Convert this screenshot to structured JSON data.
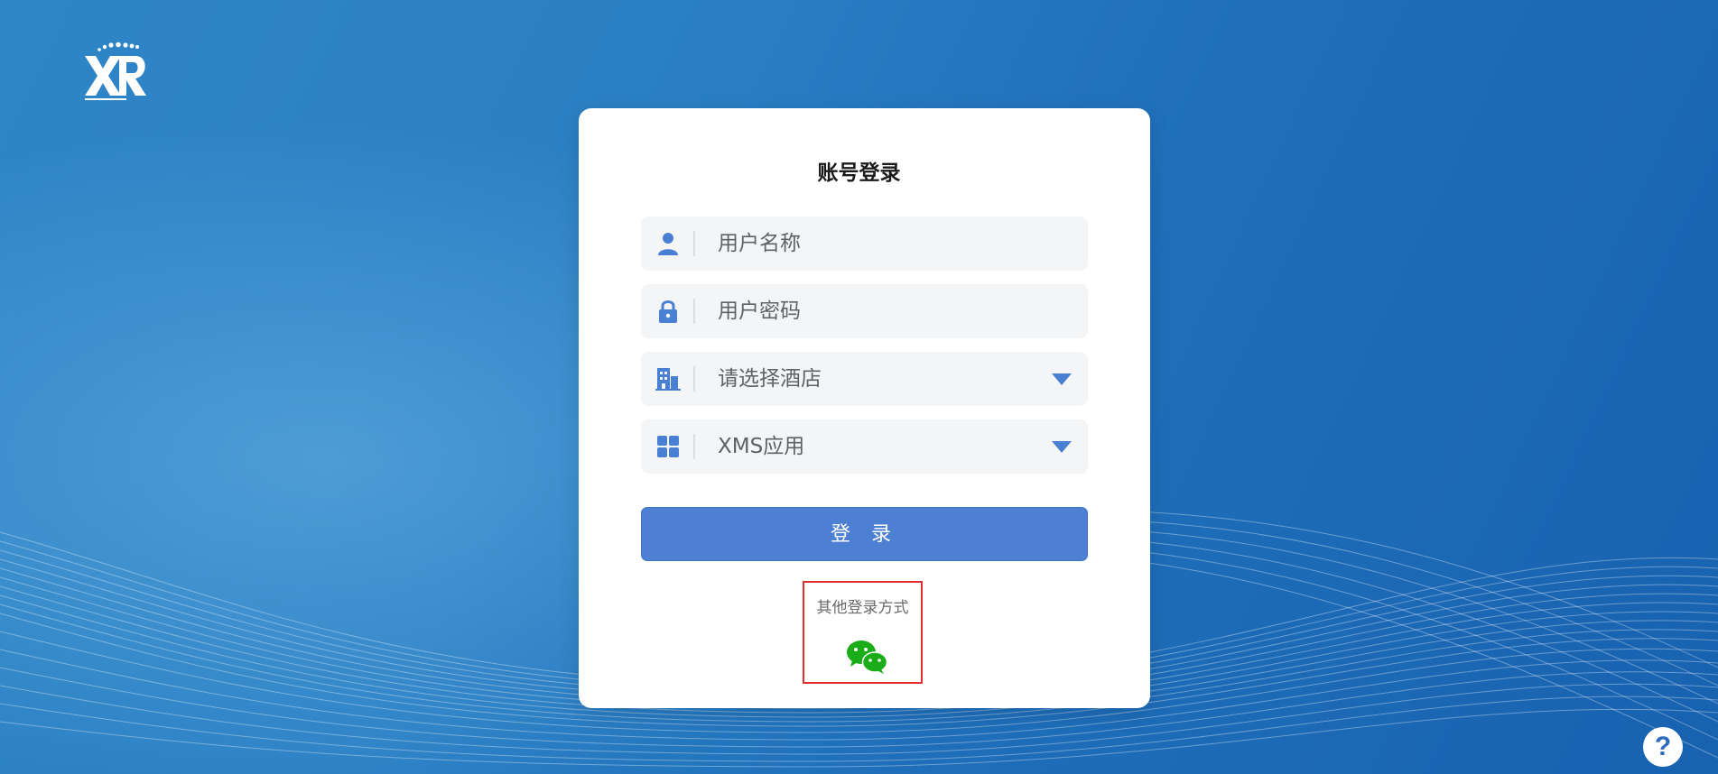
{
  "login": {
    "title": "账号登录",
    "username_placeholder": "用户名称",
    "password_placeholder": "用户密码",
    "hotel_select_value": "请选择酒店",
    "app_select_value": "XMS应用",
    "login_button": "登 录",
    "other_login_label": "其他登录方式"
  },
  "help": {
    "label": "?"
  },
  "colors": {
    "accent": "#4d7fd3",
    "icon": "#4a80d4",
    "wechat": "#1aad19",
    "highlight_border": "#e03030"
  },
  "icons": {
    "username": "user-icon",
    "password": "lock-icon",
    "hotel": "building-icon",
    "app": "grid-icon",
    "wechat": "wechat-icon",
    "logo": "xr-logo"
  }
}
